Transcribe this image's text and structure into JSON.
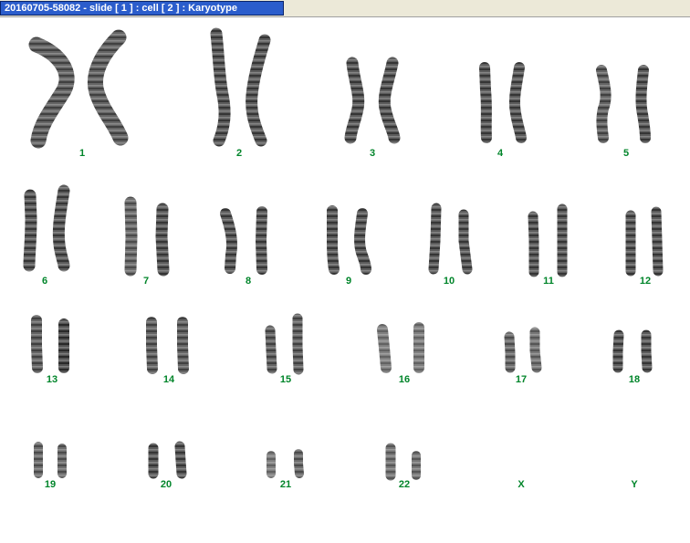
{
  "window": {
    "title": "20160705-58082 - slide [ 1 ] : cell [ 2 ] : Karyotype"
  },
  "colors": {
    "label": "#00852a",
    "title_bar": "#2b5dcc",
    "chromosome": "#222222"
  },
  "karyotype": {
    "labels": [
      "1",
      "2",
      "3",
      "4",
      "5",
      "6",
      "7",
      "8",
      "9",
      "10",
      "11",
      "12",
      "13",
      "14",
      "15",
      "16",
      "17",
      "18",
      "19",
      "20",
      "21",
      "22",
      "X",
      "Y"
    ]
  }
}
